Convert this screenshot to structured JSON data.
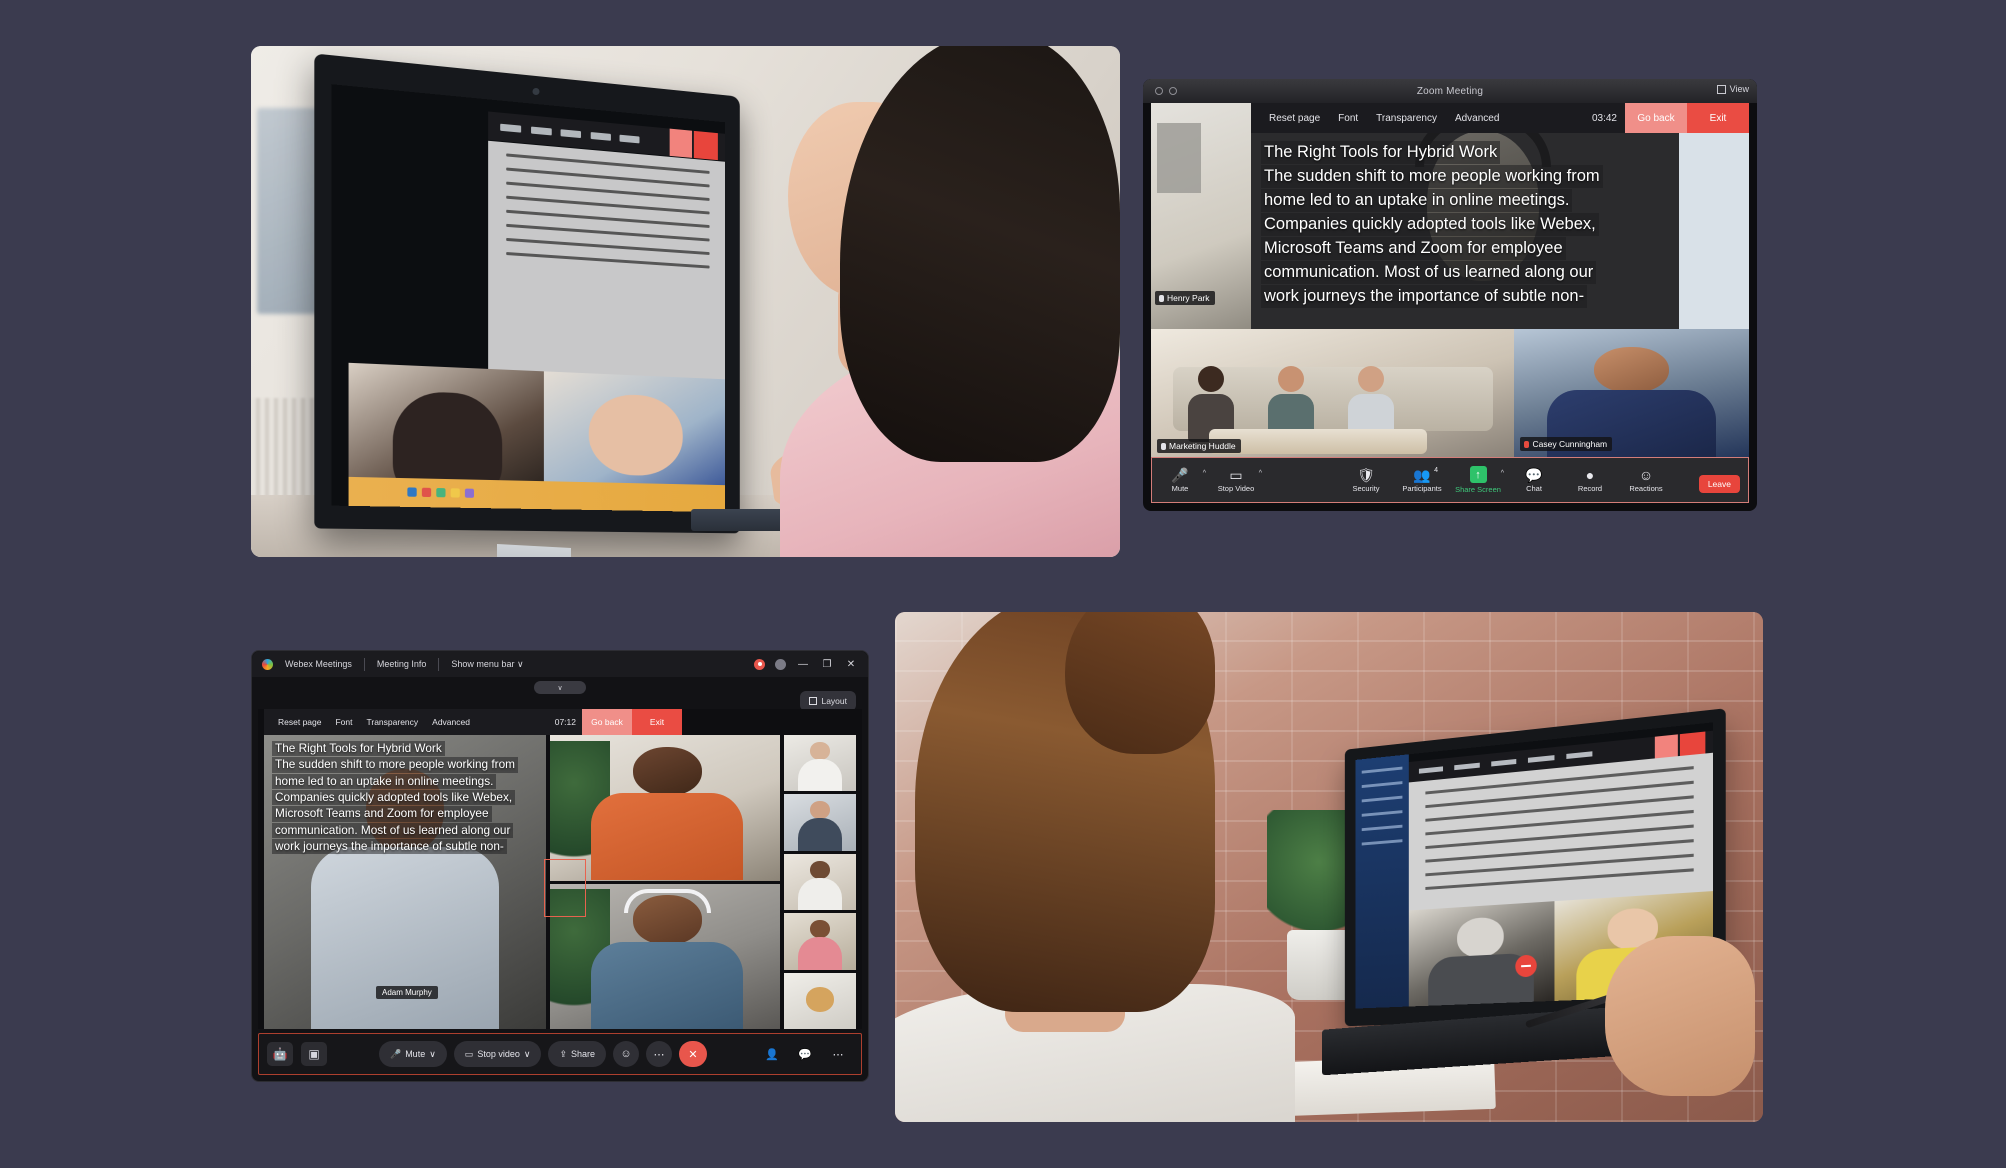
{
  "background_color": "#3b3b4f",
  "collage": {
    "panels": [
      {
        "name": "woman-at-desktop-photo",
        "kind": "photograph"
      },
      {
        "name": "zoom-meeting-screenshot",
        "kind": "app-screenshot"
      },
      {
        "name": "webex-meeting-screenshot",
        "kind": "app-screenshot"
      },
      {
        "name": "woman-with-laptop-photo",
        "kind": "photograph"
      }
    ]
  },
  "teleprompter": {
    "toolbar": {
      "reset_page": "Reset page",
      "font": "Font",
      "transparency": "Transparency",
      "advanced": "Advanced",
      "go_back": "Go back",
      "exit": "Exit",
      "go_back_color": "#f08f89",
      "exit_color": "#ea4c43"
    },
    "script_lines": [
      "The Right Tools for Hybrid Work",
      "The sudden shift to more people working from",
      "home led to an uptake in online meetings.",
      "Companies quickly adopted tools like Webex,",
      "Microsoft Teams and Zoom for employee",
      "communication. Most of us learned along our",
      "work journeys the importance of subtle non-"
    ]
  },
  "zoom_window": {
    "title": "Zoom Meeting",
    "view_label": "View",
    "timer": "03:42",
    "meeting_name": "Marketing Huddle",
    "participants": [
      {
        "name": "Henry Park",
        "speaking": true
      },
      {
        "name": "Casey Cunningham",
        "muted": true
      }
    ],
    "toolbar": [
      {
        "label": "Mute",
        "icon": "microphone-icon",
        "has_caret": true
      },
      {
        "label": "Stop Video",
        "icon": "video-camera-icon",
        "has_caret": true
      },
      {
        "label": "Security",
        "icon": "shield-icon",
        "has_caret": false
      },
      {
        "label": "Participants",
        "icon": "people-icon",
        "badge": "4",
        "has_caret": false
      },
      {
        "label": "Share Screen",
        "icon": "share-screen-icon",
        "has_caret": true,
        "accent": "#2ec26a"
      },
      {
        "label": "Chat",
        "icon": "chat-bubble-icon",
        "has_caret": false
      },
      {
        "label": "Record",
        "icon": "record-icon",
        "has_caret": false
      },
      {
        "label": "Reactions",
        "icon": "reactions-icon",
        "has_caret": false
      }
    ],
    "leave_label": "Leave",
    "leave_color": "#e8453c"
  },
  "webex_window": {
    "app_name": "Webex Meetings",
    "meeting_info": "Meeting Info",
    "show_menu_bar": "Show menu bar",
    "layout_label": "Layout",
    "timer": "07:12",
    "presenter_name": "Adam Murphy",
    "window_controls": {
      "minimize": "—",
      "maximize": "❐",
      "close": "✕"
    },
    "toolbar": [
      {
        "label": "Mute",
        "icon": "microphone-icon",
        "has_caret": true
      },
      {
        "label": "Stop video",
        "icon": "video-camera-icon",
        "has_caret": true
      },
      {
        "label": "Share",
        "icon": "share-icon",
        "has_caret": false
      }
    ],
    "end_call_label": "✕",
    "end_call_color": "#e8564c",
    "grid_tiles": 2,
    "thumbnail_count": 5
  }
}
